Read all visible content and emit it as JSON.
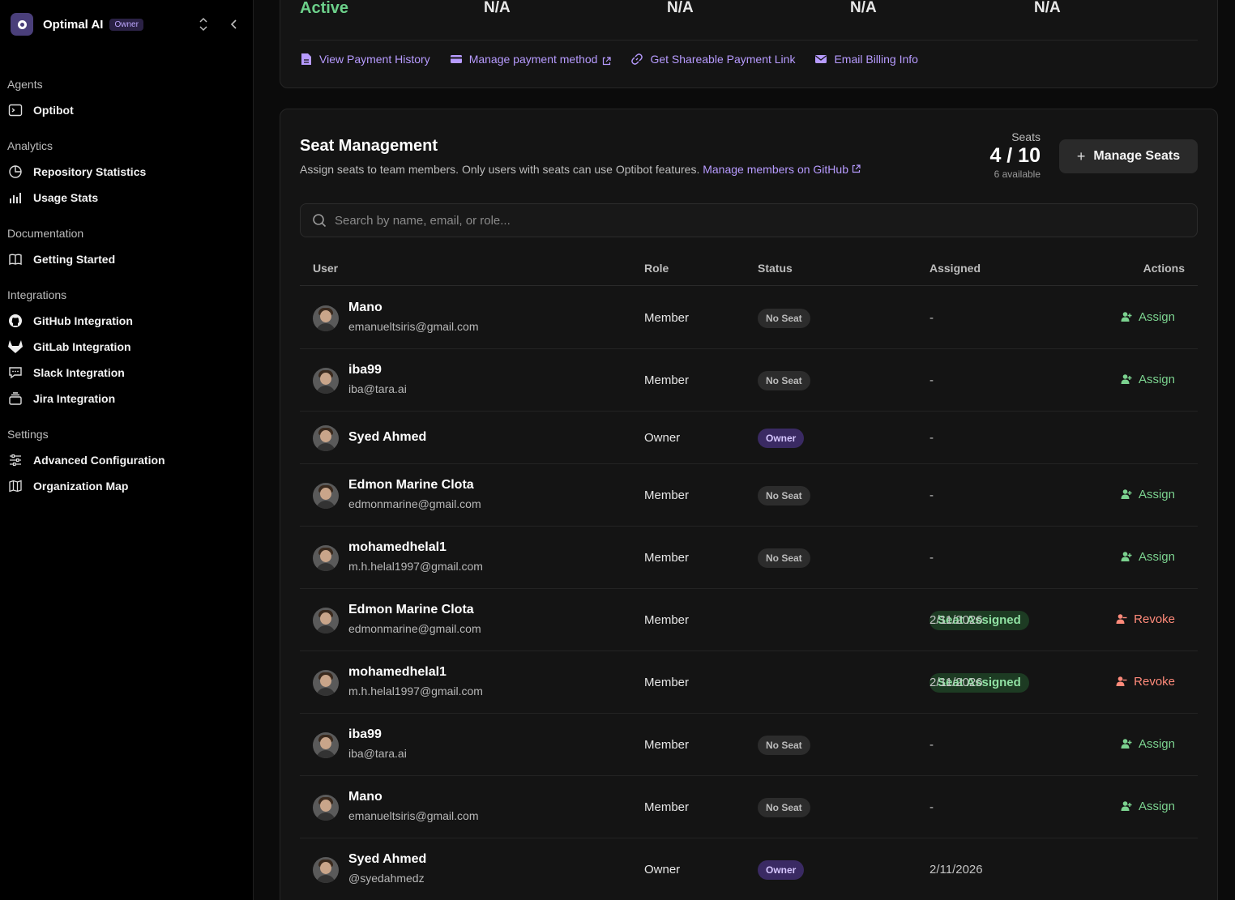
{
  "org": {
    "name": "Optimal AI",
    "badge": "Owner"
  },
  "sidebar": {
    "sections": [
      {
        "title": "Agents",
        "items": [
          {
            "label": "Optibot",
            "icon": "terminal-icon"
          }
        ]
      },
      {
        "title": "Analytics",
        "items": [
          {
            "label": "Repository Statistics",
            "icon": "pie-chart-icon"
          },
          {
            "label": "Usage Stats",
            "icon": "bar-chart-icon"
          }
        ]
      },
      {
        "title": "Documentation",
        "items": [
          {
            "label": "Getting Started",
            "icon": "book-icon"
          }
        ]
      },
      {
        "title": "Integrations",
        "items": [
          {
            "label": "GitHub Integration",
            "icon": "github-icon"
          },
          {
            "label": "GitLab Integration",
            "icon": "gitlab-icon"
          },
          {
            "label": "Slack Integration",
            "icon": "message-icon"
          },
          {
            "label": "Jira Integration",
            "icon": "archive-icon"
          }
        ]
      },
      {
        "title": "Settings",
        "items": [
          {
            "label": "Advanced Configuration",
            "icon": "sliders-icon"
          },
          {
            "label": "Organization Map",
            "icon": "map-icon"
          }
        ]
      }
    ]
  },
  "billing": {
    "status": "Active",
    "values": [
      "N/A",
      "N/A",
      "N/A",
      "N/A"
    ],
    "links": [
      {
        "label": "View Payment History",
        "icon": "file-icon",
        "external": false
      },
      {
        "label": "Manage payment method",
        "icon": "credit-card-icon",
        "external": true
      },
      {
        "label": "Get Shareable Payment Link",
        "icon": "link-icon",
        "external": false
      },
      {
        "label": "Email Billing Info",
        "icon": "mail-icon",
        "external": false
      }
    ]
  },
  "seats": {
    "title": "Seat Management",
    "description": "Assign seats to team members. Only users with seats can use Optibot features.",
    "github_link": "Manage members on GitHub",
    "label": "Seats",
    "count": "4 / 10",
    "available": "6 available",
    "manage_button": "Manage Seats",
    "search_placeholder": "Search by name, email, or role...",
    "columns": {
      "user": "User",
      "role": "Role",
      "status": "Status",
      "assigned": "Assigned",
      "actions": "Actions"
    },
    "rows": [
      {
        "name": "Mano",
        "email": "emanueltsiris@gmail.com",
        "role": "Member",
        "status": "No Seat",
        "status_type": "noseat",
        "assigned": "-",
        "action": "Assign",
        "action_type": "assign"
      },
      {
        "name": "iba99",
        "email": "iba@tara.ai",
        "role": "Member",
        "status": "No Seat",
        "status_type": "noseat",
        "assigned": "-",
        "action": "Assign",
        "action_type": "assign"
      },
      {
        "name": "Syed Ahmed",
        "email": "",
        "role": "Owner",
        "status": "Owner",
        "status_type": "owner",
        "assigned": "-",
        "action": "",
        "action_type": "none"
      },
      {
        "name": "Edmon Marine Clota",
        "email": "edmonmarine@gmail.com",
        "role": "Member",
        "status": "No Seat",
        "status_type": "noseat",
        "assigned": "-",
        "action": "Assign",
        "action_type": "assign"
      },
      {
        "name": "mohamedhelal1",
        "email": "m.h.helal1997@gmail.com",
        "role": "Member",
        "status": "No Seat",
        "status_type": "noseat",
        "assigned": "-",
        "action": "Assign",
        "action_type": "assign"
      },
      {
        "name": "Edmon Marine Clota",
        "email": "edmonmarine@gmail.com",
        "role": "Member",
        "status": "Seat Assigned",
        "status_type": "assigned",
        "assigned": "2/11/2026",
        "action": "Revoke",
        "action_type": "revoke"
      },
      {
        "name": "mohamedhelal1",
        "email": "m.h.helal1997@gmail.com",
        "role": "Member",
        "status": "Seat Assigned",
        "status_type": "assigned",
        "assigned": "2/11/2026",
        "action": "Revoke",
        "action_type": "revoke"
      },
      {
        "name": "iba99",
        "email": "iba@tara.ai",
        "role": "Member",
        "status": "No Seat",
        "status_type": "noseat",
        "assigned": "-",
        "action": "Assign",
        "action_type": "assign"
      },
      {
        "name": "Mano",
        "email": "emanueltsiris@gmail.com",
        "role": "Member",
        "status": "No Seat",
        "status_type": "noseat",
        "assigned": "-",
        "action": "Assign",
        "action_type": "assign"
      },
      {
        "name": "Syed Ahmed",
        "email": "@syedahmedz",
        "role": "Owner",
        "status": "Owner",
        "status_type": "owner",
        "assigned": "2/11/2026",
        "action": "",
        "action_type": "none"
      }
    ]
  }
}
